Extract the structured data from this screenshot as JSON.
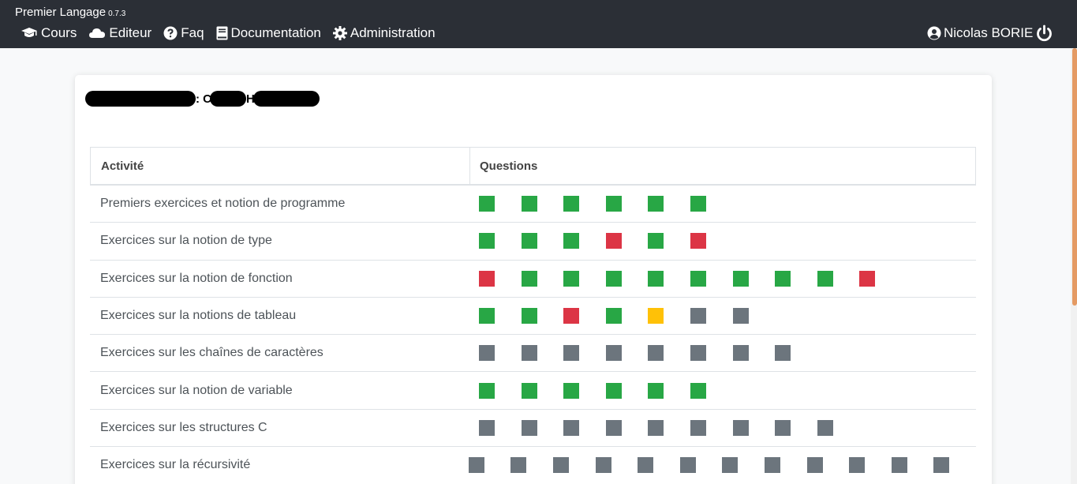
{
  "app": {
    "name": "Premier Langage",
    "version": "0.7.3"
  },
  "nav": [
    {
      "label": "Cours",
      "icon": "graduation-cap-icon"
    },
    {
      "label": "Editeur",
      "icon": "cloud-icon"
    },
    {
      "label": "Faq",
      "icon": "question-circle-icon"
    },
    {
      "label": "Documentation",
      "icon": "book-icon"
    },
    {
      "label": "Administration",
      "icon": "gear-icon"
    }
  ],
  "user": {
    "name": "Nicolas BORIE",
    "icon": "user-circle-icon",
    "logout_icon": "power-icon"
  },
  "student": {
    "separator": ": C",
    "middle": "H"
  },
  "colors": {
    "green": "#28a745",
    "red": "#dc3545",
    "yellow": "#ffc107",
    "gray": "#6c757d"
  },
  "table": {
    "headers": {
      "activity": "Activité",
      "questions": "Questions"
    },
    "rows": [
      {
        "activity": "Premiers exercices et notion de programme",
        "questions": [
          "green",
          "green",
          "green",
          "green",
          "green",
          "green"
        ]
      },
      {
        "activity": "Exercices sur la notion de type",
        "questions": [
          "green",
          "green",
          "green",
          "red",
          "green",
          "red"
        ]
      },
      {
        "activity": "Exercices sur la notion de fonction",
        "questions": [
          "red",
          "green",
          "green",
          "green",
          "green",
          "green",
          "green",
          "green",
          "green",
          "red"
        ]
      },
      {
        "activity": "Exercices sur la notions de tableau",
        "questions": [
          "green",
          "green",
          "red",
          "green",
          "yellow",
          "gray",
          "gray"
        ]
      },
      {
        "activity": "Exercices sur les chaînes de caractères",
        "questions": [
          "gray",
          "gray",
          "gray",
          "gray",
          "gray",
          "gray",
          "gray",
          "gray"
        ]
      },
      {
        "activity": "Exercices sur la notion de variable",
        "questions": [
          "green",
          "green",
          "green",
          "green",
          "green",
          "green"
        ]
      },
      {
        "activity": "Exercices sur les structures C",
        "questions": [
          "gray",
          "gray",
          "gray",
          "gray",
          "gray",
          "gray",
          "gray",
          "gray",
          "gray"
        ]
      },
      {
        "activity": "Exercices sur la récursivité",
        "questions": [
          "gray",
          "gray",
          "gray",
          "gray",
          "gray",
          "gray",
          "gray",
          "gray",
          "gray",
          "gray",
          "gray",
          "gray"
        ]
      }
    ]
  }
}
